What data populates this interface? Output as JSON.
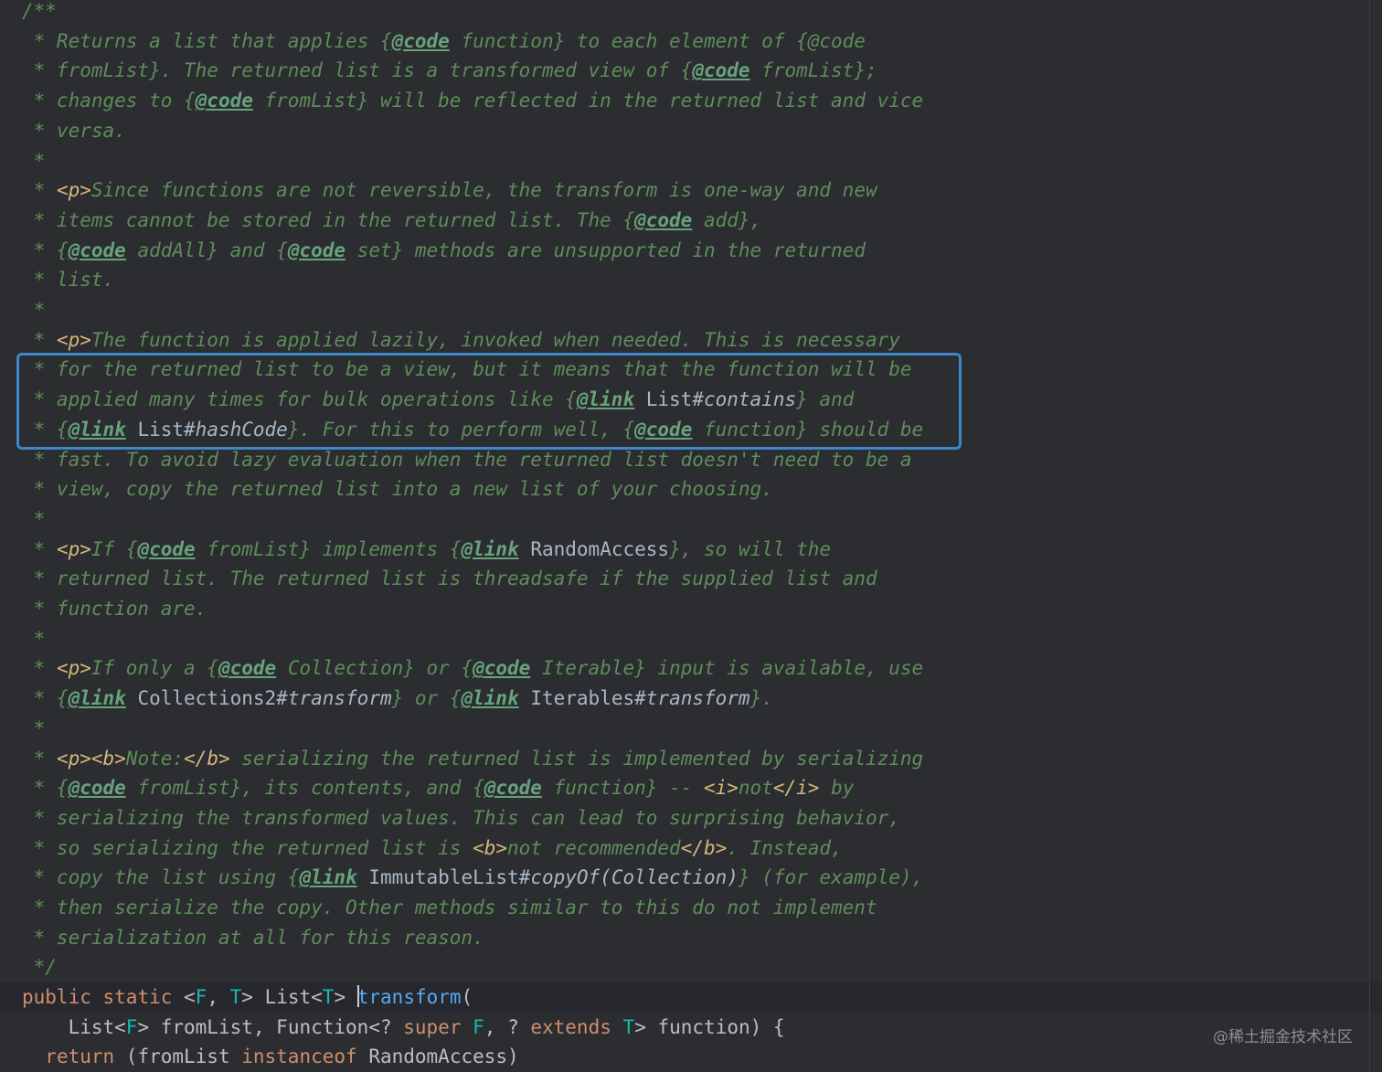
{
  "editor": {
    "doc_lines": [
      "/**",
      " * Returns a list that applies {@code function} to each element of {@code",
      " * fromList}. The returned list is a transformed view of {@code fromList};",
      " * changes to {@code fromList} will be reflected in the returned list and vice",
      " * versa.",
      " *",
      " * <p>Since functions are not reversible, the transform is one-way and new",
      " * items cannot be stored in the returned list. The {@code add},",
      " * {@code addAll} and {@code set} methods are unsupported in the returned",
      " * list.",
      " *",
      " * <p>The function is applied lazily, invoked when needed. This is necessary",
      " * for the returned list to be a view, but it means that the function will be",
      " * applied many times for bulk operations like {@link List#contains} and",
      " * {@link List#hashCode}. For this to perform well, {@code function} should be",
      " * fast. To avoid lazy evaluation when the returned list doesn't need to be a",
      " * view, copy the returned list into a new list of your choosing.",
      " *",
      " * <p>If {@code fromList} implements {@link RandomAccess}, so will the",
      " * returned list. The returned list is threadsafe if the supplied list and",
      " * function are.",
      " *",
      " * <p>If only a {@code Collection} or {@code Iterable} input is available, use",
      " * {@link Collections2#transform} or {@link Iterables#transform}.",
      " *",
      " * <p><b>Note:</b> serializing the returned list is implemented by serializing",
      " * {@code fromList}, its contents, and {@code function} -- <i>not</i> by",
      " * serializing the transformed values. This can lead to surprising behavior,",
      " * so serializing the returned list is <b>not recommended</b>. Instead,",
      " * copy the list using {@link ImmutableList#copyOf(Collection)} (for example),",
      " * then serialize the copy. Other methods similar to this do not implement",
      " * serialization at all for this reason.",
      " */"
    ],
    "code_lines": [
      "public static <F, T> List<T> transform(",
      "    List<F> fromList, Function<? super F, ? extends T> function) {",
      "  return (fromList instanceof RandomAccess)"
    ]
  },
  "watermark": "@稀土掘金技术社区",
  "colors": {
    "background": "#2b2d30",
    "comment": "#5f8c5b",
    "doc_tag": "#67a37c",
    "html_tag": "#d5b778",
    "keyword": "#cf8e6d",
    "type_param": "#16baac",
    "method": "#56a8f5",
    "highlight_box": "#3c88c9"
  }
}
